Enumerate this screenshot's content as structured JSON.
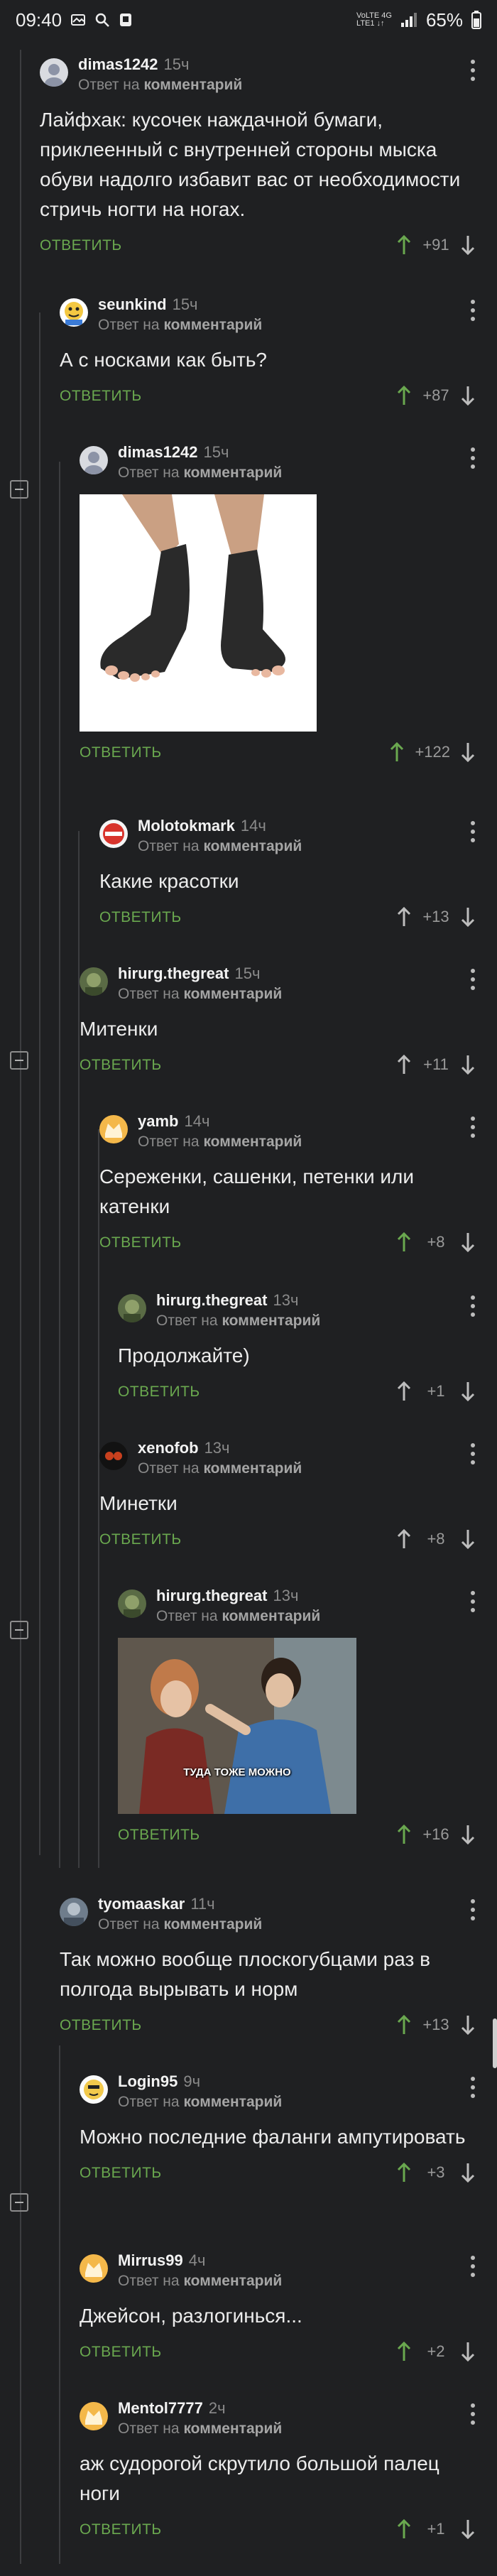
{
  "status_bar": {
    "time": "09:40",
    "net_top": "VoLTE 4G",
    "net_bottom": "LTE1 ↓↑",
    "battery": "65%"
  },
  "labels": {
    "reply": "ОТВЕТИТЬ",
    "reply_prefix": "Ответ на",
    "reply_target": "комментарий"
  },
  "comments": [
    {
      "author": "dimas1242",
      "time": "15ч",
      "text": "Лайфхак: кусочек наждачной бумаги, приклеенный с внутренней стороны мыска обуви надолго избавит вас от необходимости стричь ногти на ногах.",
      "score": "+91"
    },
    {
      "author": "seunkind",
      "time": "15ч",
      "text": "А с носками как быть?",
      "score": "+87"
    },
    {
      "author": "dimas1242",
      "time": "15ч",
      "text": "",
      "score": "+122"
    },
    {
      "author": "Molotokmark",
      "time": "14ч",
      "text": "Какие красотки",
      "score": "+13"
    },
    {
      "author": "hirurg.thegreat",
      "time": "15ч",
      "text": "Митенки",
      "score": "+11"
    },
    {
      "author": "yamb",
      "time": "14ч",
      "text": "Сереженки, сашенки, петенки или катенки",
      "score": "+8"
    },
    {
      "author": "hirurg.thegreat",
      "time": "13ч",
      "text": "Продолжайте)",
      "score": "+1"
    },
    {
      "author": "xenofob",
      "time": "13ч",
      "text": "Минетки",
      "score": "+8"
    },
    {
      "author": "hirurg.thegreat",
      "time": "13ч",
      "text": "",
      "image_caption": "ТУДА ТОЖЕ МОЖНО",
      "score": "+16"
    },
    {
      "author": "tyomaaskar",
      "time": "11ч",
      "text": "Так можно вообще плоскогубцами раз в полгода вырывать и норм",
      "score": "+13"
    },
    {
      "author": "Login95",
      "time": "9ч",
      "text": "Можно последние фаланги ампутировать",
      "score": "+3"
    },
    {
      "author": "Mirrus99",
      "time": "4ч",
      "text": "Джейсон, разлогинься...",
      "score": "+2"
    },
    {
      "author": "Mentol7777",
      "time": "2ч",
      "text": "аж судорогой скрутило большой палец ноги",
      "score": "+1"
    }
  ],
  "colors": {
    "background": "#1f2022",
    "reply": "#6aa84f",
    "upvote": "#6aa84f",
    "muted": "#8a8a8a"
  }
}
